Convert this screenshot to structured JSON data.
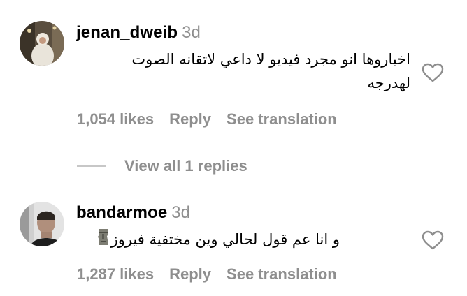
{
  "comments": [
    {
      "username": "jenan_dweib",
      "time": "3d",
      "text_line1": "اخباروها انو مجرد فيديو لا داعي لاتقانه الصوت",
      "text_line2": "لهدرجه",
      "likes": "1,054 likes",
      "reply": "Reply",
      "translate": "See translation",
      "heart_icon": "heart-outline-icon"
    },
    {
      "username": "bandarmoe",
      "time": "3d",
      "text_line1": "و انا عم قول لحالي وين مختفية فيروز",
      "emoji": "moai-emoji",
      "likes": "1,287 likes",
      "reply": "Reply",
      "translate": "See translation",
      "heart_icon": "heart-outline-icon"
    }
  ],
  "replies": {
    "label": "View all 1 replies"
  },
  "colors": {
    "text": "#000000",
    "secondary": "#8e8e8e",
    "divider": "#c7c7c7"
  }
}
